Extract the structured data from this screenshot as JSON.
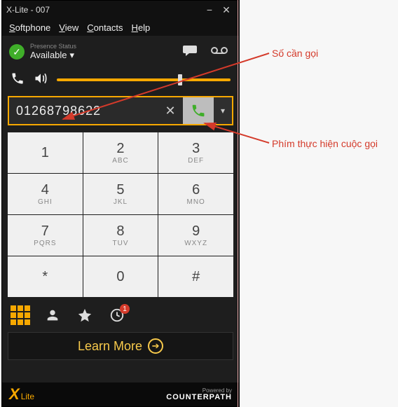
{
  "window": {
    "title": "X-Lite - 007"
  },
  "menu": {
    "softphone": "Softphone",
    "view": "View",
    "contacts": "Contacts",
    "help": "Help"
  },
  "presence": {
    "label": "Presence Status",
    "status": "Available"
  },
  "dial": {
    "number": "01268798622"
  },
  "keypad": [
    {
      "digit": "1",
      "letters": ""
    },
    {
      "digit": "2",
      "letters": "ABC"
    },
    {
      "digit": "3",
      "letters": "DEF"
    },
    {
      "digit": "4",
      "letters": "GHI"
    },
    {
      "digit": "5",
      "letters": "JKL"
    },
    {
      "digit": "6",
      "letters": "MNO"
    },
    {
      "digit": "7",
      "letters": "PQRS"
    },
    {
      "digit": "8",
      "letters": "TUV"
    },
    {
      "digit": "9",
      "letters": "WXYZ"
    },
    {
      "digit": "*",
      "letters": ""
    },
    {
      "digit": "0",
      "letters": ""
    },
    {
      "digit": "#",
      "letters": ""
    }
  ],
  "tabs": {
    "history_badge": "1"
  },
  "learn_more": "Learn More",
  "footer": {
    "brand_x": "X",
    "brand_lite": "Lite",
    "powered_by": "Powered by",
    "counterpath": "COUNTERPATH"
  },
  "annotations": {
    "number_label": "Số cần gọi",
    "call_button_label": "Phím thực hiện cuộc gọi"
  }
}
